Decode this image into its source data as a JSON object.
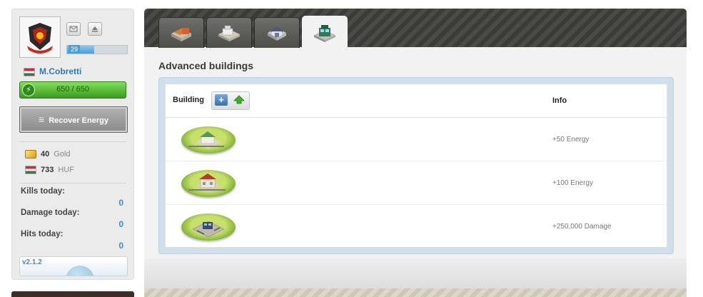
{
  "sidebar": {
    "level": "29",
    "level_progress": 0.45,
    "username": "M.Cobretti",
    "energy_text": "650 / 650",
    "energy_fraction": 1.0,
    "recover_label": "Recover Energy",
    "gold_amount": "40",
    "gold_unit": "Gold",
    "currency_amount": "733",
    "currency_unit": "HUF",
    "stats": [
      {
        "label": "Kills today:",
        "value": "0"
      },
      {
        "label": "Damage today:",
        "value": "0"
      },
      {
        "label": "Hits today:",
        "value": "0"
      }
    ],
    "version": "v2.1.2",
    "colors": {
      "link": "#2d7bb5",
      "energy": "#3c9a1f",
      "stat_value": "#3a8fc8"
    }
  },
  "tabs": [
    {
      "icon": "shop-building-icon",
      "active": false
    },
    {
      "icon": "factory-building-icon",
      "active": false
    },
    {
      "icon": "storage-building-icon",
      "active": false
    },
    {
      "icon": "advanced-building-icon",
      "active": true
    }
  ],
  "main": {
    "title": "Advanced buildings",
    "table": {
      "col_building": "Building",
      "col_info": "Info",
      "sort_buttons": [
        "plus-icon",
        "upgrade-arrow-icon"
      ],
      "rows": [
        {
          "building_icon": "house-green-roof-icon",
          "info": "+50 Energy"
        },
        {
          "building_icon": "house-red-roof-icon",
          "info": "+100 Energy"
        },
        {
          "building_icon": "military-base-icon",
          "info": "+250,000 Damage"
        }
      ]
    }
  }
}
